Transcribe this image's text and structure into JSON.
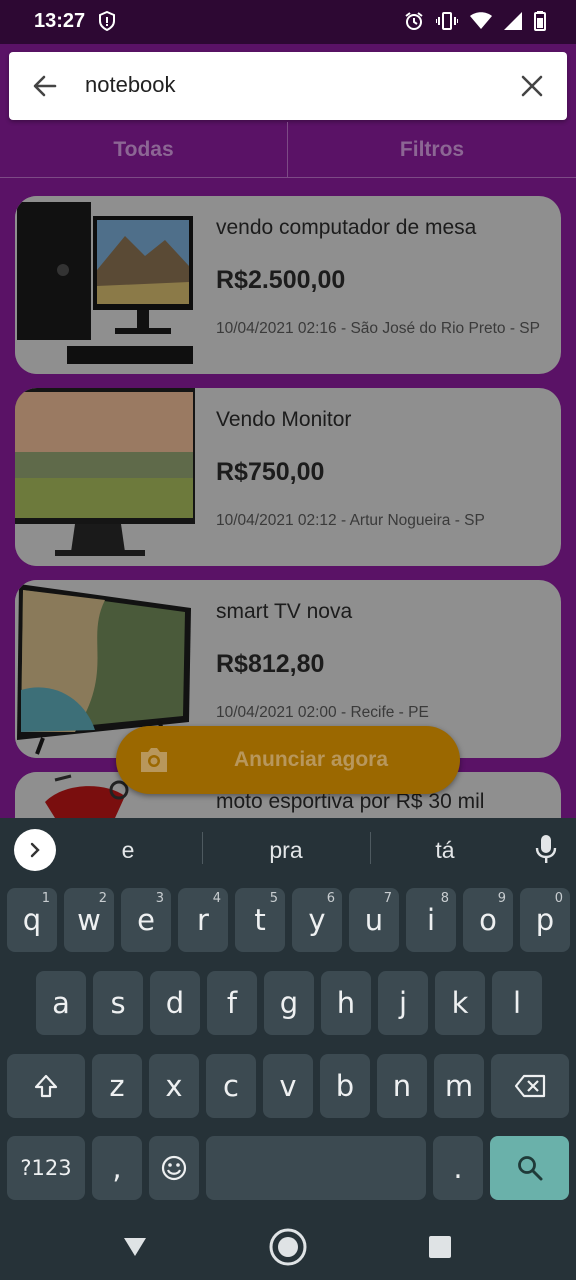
{
  "status_bar": {
    "time": "13:27",
    "icons": [
      "shield-alert-icon",
      "alarm-icon",
      "vibrate-icon",
      "wifi-icon",
      "signal-icon",
      "battery-icon"
    ]
  },
  "search": {
    "query": "notebook",
    "back_icon": "arrow-left-icon",
    "clear_icon": "close-icon"
  },
  "tabs": [
    {
      "label": "Todas"
    },
    {
      "label": "Filtros"
    }
  ],
  "listings": [
    {
      "title": "vendo computador de mesa",
      "price": "R$2.500,00",
      "meta": "10/04/2021 02:16 - São José do Rio Preto - SP",
      "image": "desktop-computer-photo"
    },
    {
      "title": "Vendo Monitor",
      "price": "R$750,00",
      "meta": "10/04/2021 02:12 - Artur Nogueira - SP",
      "image": "monitor-photo"
    },
    {
      "title": "smart TV nova",
      "price": "R$812,80",
      "meta": "10/04/2021 02:00 - Recife - PE",
      "image": "smart-tv-photo"
    },
    {
      "title": "moto esportiva por R$ 30 mil",
      "image": "motorcycle-photo"
    }
  ],
  "fab": {
    "label": "Anunciar agora",
    "icon": "camera-icon"
  },
  "keyboard": {
    "suggestions": [
      "e",
      "pra",
      "tá"
    ],
    "row1": [
      {
        "k": "q",
        "h": "1"
      },
      {
        "k": "w",
        "h": "2"
      },
      {
        "k": "e",
        "h": "3"
      },
      {
        "k": "r",
        "h": "4"
      },
      {
        "k": "t",
        "h": "5"
      },
      {
        "k": "y",
        "h": "6"
      },
      {
        "k": "u",
        "h": "7"
      },
      {
        "k": "i",
        "h": "8"
      },
      {
        "k": "o",
        "h": "9"
      },
      {
        "k": "p",
        "h": "0"
      }
    ],
    "row2": [
      "a",
      "s",
      "d",
      "f",
      "g",
      "h",
      "j",
      "k",
      "l"
    ],
    "row3": [
      "z",
      "x",
      "c",
      "v",
      "b",
      "n",
      "m"
    ],
    "symbols_label": "?123",
    "comma": ",",
    "period": "."
  },
  "colors": {
    "app_bg": "#5a1266",
    "fab": "#9b6800",
    "keyboard_bg": "#263238",
    "search_key": "#6ab1aa"
  }
}
